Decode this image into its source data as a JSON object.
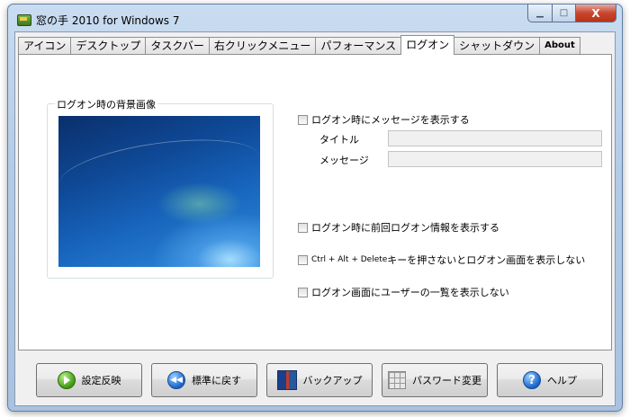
{
  "window": {
    "title": "窓の手 2010 for Windows 7",
    "controls": {
      "minimize": "▁",
      "maximize": "□",
      "close": "X"
    }
  },
  "tabs": [
    {
      "label": "アイコン",
      "active": false
    },
    {
      "label": "デスクトップ",
      "active": false
    },
    {
      "label": "タスクバー",
      "active": false
    },
    {
      "label": "右クリックメニュー",
      "active": false
    },
    {
      "label": "パフォーマンス",
      "active": false
    },
    {
      "label": "ログオン",
      "active": true
    },
    {
      "label": "シャットダウン",
      "active": false
    },
    {
      "label": "About",
      "active": false
    }
  ],
  "logon": {
    "bg_group_label": "ログオン時の背景画像",
    "show_message": {
      "label": "ログオン時にメッセージを表示する",
      "checked": false
    },
    "title_label": "タイトル",
    "title_value": "",
    "message_label": "メッセージ",
    "message_value": "",
    "show_prev_info": {
      "label": "ログオン時に前回ログオン情報を表示する",
      "checked": false
    },
    "ctrl_alt_del": {
      "label_prefix": "Ctrl + Alt + Delete",
      "label_suffix": "キーを押さないとログオン画面を表示しない",
      "checked": false
    },
    "hide_user_list": {
      "label": "ログオン画面にユーザーの一覧を表示しない",
      "checked": false
    }
  },
  "buttons": {
    "apply": "設定反映",
    "reset": "標準に戻す",
    "backup": "バックアップ",
    "password": "パスワード変更",
    "help": "ヘルプ"
  },
  "icons": {
    "app": "window-hand-icon",
    "apply": "green-play-icon",
    "reset": "blue-rewind-icon",
    "backup": "book-icon",
    "password": "keypad-icon",
    "help": "question-mark-icon"
  }
}
